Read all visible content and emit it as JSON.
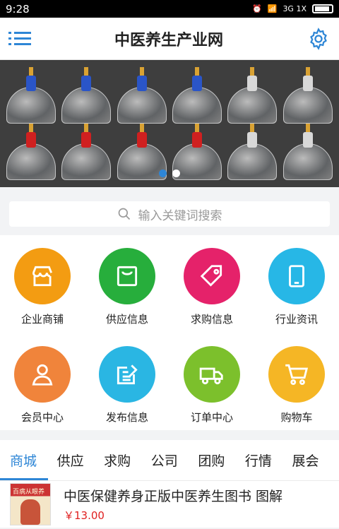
{
  "status": {
    "time": "9:28",
    "network": "3G 1X"
  },
  "header": {
    "title": "中医养生产业网"
  },
  "banner": {
    "dots": 2,
    "active_dot": 1
  },
  "search": {
    "placeholder": "输入关键词搜索"
  },
  "grid": [
    {
      "label": "企业商铺",
      "color": "#f39c12",
      "icon": "store-icon"
    },
    {
      "label": "供应信息",
      "color": "#27ae3c",
      "icon": "shopping-bag-icon"
    },
    {
      "label": "求购信息",
      "color": "#e5226a",
      "icon": "tag-icon"
    },
    {
      "label": "行业资讯",
      "color": "#27b7e6",
      "icon": "tablet-icon"
    },
    {
      "label": "会员中心",
      "color": "#f0843b",
      "icon": "user-icon"
    },
    {
      "label": "发布信息",
      "color": "#2ab6e3",
      "icon": "edit-icon"
    },
    {
      "label": "订单中心",
      "color": "#7cc02c",
      "icon": "truck-icon"
    },
    {
      "label": "购物车",
      "color": "#f5b625",
      "icon": "cart-icon"
    }
  ],
  "tabs": [
    "商城",
    "供应",
    "求购",
    "公司",
    "团购",
    "行情",
    "展会"
  ],
  "product": {
    "title": "中医保健养身正版中医养生图书 图解",
    "price": "￥13.00",
    "thumb_text": "百病从眼养"
  },
  "colors": {
    "accent": "#2e86d6",
    "price": "#e02020"
  }
}
